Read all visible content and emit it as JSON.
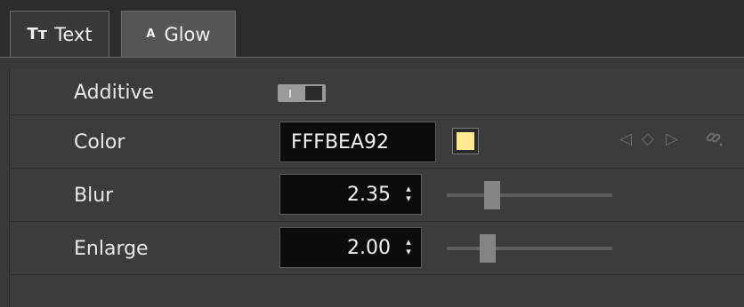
{
  "tabs": [
    {
      "label": "Text",
      "icon": "text-type-icon",
      "glyph": "Tт"
    },
    {
      "label": "Glow",
      "icon": "glow-a-icon",
      "glyph": "A"
    }
  ],
  "rows": {
    "additive": {
      "label": "Additive",
      "toggle_on": true
    },
    "color": {
      "label": "Color",
      "hex": "FFFBEA92",
      "swatch": "#FFEA92"
    },
    "blur": {
      "label": "Blur",
      "value": "2.35",
      "slider_fraction": 0.25
    },
    "enlarge": {
      "label": "Enlarge",
      "value": "2.00",
      "slider_fraction": 0.22
    }
  },
  "keyframe_icons": {
    "prev": "◁",
    "add": "◇",
    "next": "▷",
    "link": "🔗"
  },
  "spin_glyph": "⌃⌄"
}
